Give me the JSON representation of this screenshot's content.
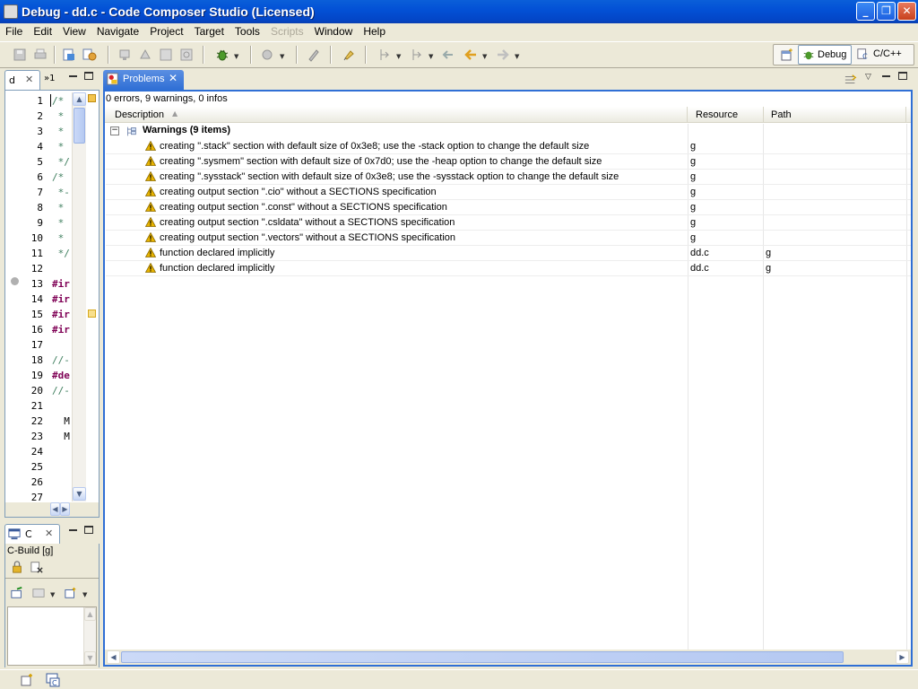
{
  "window": {
    "title": "Debug - dd.c - Code Composer Studio (Licensed)",
    "min_glyph": "_",
    "max_glyph": "❐",
    "close_glyph": "✕"
  },
  "menu": [
    "File",
    "Edit",
    "View",
    "Navigate",
    "Project",
    "Target",
    "Tools",
    "Scripts",
    "Window",
    "Help"
  ],
  "menu_disabled": [
    "Scripts"
  ],
  "perspectives": [
    {
      "label": "Debug",
      "icon": "bug-icon",
      "active": true
    },
    {
      "label": "C/C++",
      "icon": "c-perspective-icon",
      "active": false
    }
  ],
  "editor": {
    "tabs": [
      {
        "label": "d",
        "close": "✕"
      },
      {
        "label": "»1"
      }
    ],
    "line_numbers": [
      "1",
      "2",
      "3",
      "4",
      "5",
      "6",
      "7",
      "8",
      "9",
      "10",
      "11",
      "12",
      "13",
      "14",
      "15",
      "16",
      "17",
      "18",
      "19",
      "20",
      "21",
      "22",
      "23",
      "24",
      "25",
      "26",
      "27"
    ],
    "lines": [
      {
        "text": "/*",
        "type": "comment"
      },
      {
        "text": " *",
        "type": "comment"
      },
      {
        "text": " *",
        "type": "comment"
      },
      {
        "text": " *",
        "type": "comment"
      },
      {
        "text": " */",
        "type": "comment"
      },
      {
        "text": "/*",
        "type": "comment"
      },
      {
        "text": " *-",
        "type": "comment"
      },
      {
        "text": " *",
        "type": "comment"
      },
      {
        "text": " *",
        "type": "comment"
      },
      {
        "text": " *",
        "type": "comment"
      },
      {
        "text": " */",
        "type": "comment"
      },
      {
        "text": "",
        "type": "plain"
      },
      {
        "text": "#ir",
        "type": "dir"
      },
      {
        "text": "#ir",
        "type": "dir"
      },
      {
        "text": "#ir",
        "type": "dir"
      },
      {
        "text": "#ir",
        "type": "dir"
      },
      {
        "text": "",
        "type": "plain"
      },
      {
        "text": "//-",
        "type": "comment"
      },
      {
        "text": "#de",
        "type": "dir"
      },
      {
        "text": "//-",
        "type": "comment"
      },
      {
        "text": "",
        "type": "plain"
      },
      {
        "text": "  M",
        "type": "plain"
      },
      {
        "text": "  M",
        "type": "plain"
      },
      {
        "text": "",
        "type": "plain"
      },
      {
        "text": "",
        "type": "plain"
      },
      {
        "text": "",
        "type": "plain"
      },
      {
        "text": "",
        "type": "plain"
      }
    ]
  },
  "console": {
    "tab_label": "C",
    "tab_close": "✕",
    "build_label": "C-Build [g]"
  },
  "problems": {
    "tab_label": "Problems",
    "tab_close": "✕",
    "summary": "0 errors, 9 warnings, 0 infos",
    "columns": {
      "description": "Description",
      "resource": "Resource",
      "path": "Path"
    },
    "group_label": "Warnings (9 items)",
    "group_toggle": "−",
    "rows": [
      {
        "description": "creating \".stack\" section with default size of 0x3e8; use the -stack option to change the default size",
        "resource": "g",
        "path": ""
      },
      {
        "description": "creating \".sysmem\" section with default size of 0x7d0; use the -heap option to change the default size",
        "resource": "g",
        "path": ""
      },
      {
        "description": "creating \".sysstack\" section with default size of 0x3e8; use the -sysstack option to change the default size",
        "resource": "g",
        "path": ""
      },
      {
        "description": "creating output section \".cio\" without a SECTIONS specification",
        "resource": "g",
        "path": ""
      },
      {
        "description": "creating output section \".const\" without a SECTIONS specification",
        "resource": "g",
        "path": ""
      },
      {
        "description": "creating output section \".csldata\" without a SECTIONS specification",
        "resource": "g",
        "path": ""
      },
      {
        "description": "creating output section \".vectors\" without a SECTIONS specification",
        "resource": "g",
        "path": ""
      },
      {
        "description": "function declared implicitly",
        "resource": "dd.c",
        "path": "g"
      },
      {
        "description": "function declared implicitly",
        "resource": "dd.c",
        "path": "g"
      }
    ]
  },
  "colors": {
    "title_bar": "#0351d6",
    "warning": "#e8b400",
    "comment": "#3f7f5f",
    "directive": "#7f0055",
    "active_tab": "#2f6fd5"
  }
}
